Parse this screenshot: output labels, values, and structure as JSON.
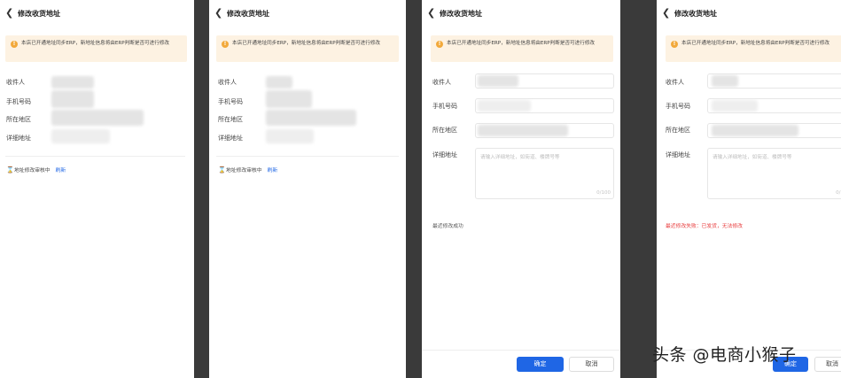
{
  "header": {
    "back_icon": "chevron-left-icon",
    "title": "修改收货地址"
  },
  "notice": {
    "icon": "warning-circle-icon",
    "text": "本店已开通地址同步ERP，新地址信息将由ERP判断是否可进行修改"
  },
  "fields": {
    "recipient": "收件人",
    "phone": "手机号码",
    "region": "所在地区",
    "address": "详细地址"
  },
  "textarea": {
    "placeholder": "请输入详细地址，如街道、楼牌号等",
    "counter": "0/100"
  },
  "status": {
    "icon": "hourglass-icon",
    "text": "地址修改审核中",
    "link": "刷新"
  },
  "messages": {
    "success": "最近修改成功",
    "failure": "最近修改失败：已发货，无法修改"
  },
  "buttons": {
    "confirm": "确定",
    "cancel": "取消"
  },
  "watermark": "头条 @电商小猴子",
  "colors": {
    "primary": "#1f66e5",
    "notice_bg": "#fdf2e2",
    "warning": "#f2a93b",
    "error": "#e8393a"
  }
}
